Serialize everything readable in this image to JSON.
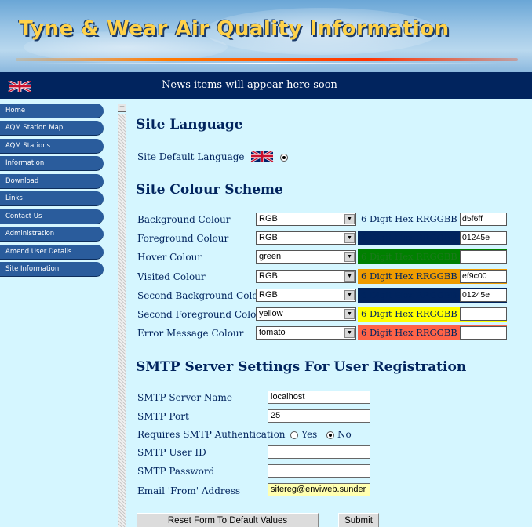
{
  "header": {
    "title": "Tyne & Wear Air Quality Information"
  },
  "newsbar": {
    "text": "News items will appear here soon",
    "flag_icon": "uk-flag-icon"
  },
  "sidebar": {
    "collapse_label": "−",
    "items": [
      {
        "label": "Home"
      },
      {
        "label": "AQM Station Map"
      },
      {
        "label": "AQM Stations"
      },
      {
        "label": "Information"
      },
      {
        "label": "Download"
      },
      {
        "label": "Links"
      },
      {
        "label": "Contact Us"
      },
      {
        "label": "Administration"
      },
      {
        "label": "Amend User Details"
      },
      {
        "label": "Site Information"
      }
    ]
  },
  "language": {
    "heading": "Site Language",
    "default_label": "Site Default Language"
  },
  "colours": {
    "heading": "Site Colour Scheme",
    "hex_label": "6 Digit Hex RRGGBB",
    "rows": [
      {
        "label": "Background Colour",
        "select": "RGB",
        "hex_value": "d5f6ff",
        "swatch": "#d5f6ff",
        "text_color": "#01245e"
      },
      {
        "label": "Foreground Colour",
        "select": "RGB",
        "hex_value": "01245e",
        "swatch": "#01245e",
        "text_color": "#01245e"
      },
      {
        "label": "Hover Colour",
        "select": "green",
        "hex_value": "",
        "swatch": "#008000",
        "text_color": "#1a7a1a"
      },
      {
        "label": "Visited Colour",
        "select": "RGB",
        "hex_value": "ef9c00",
        "swatch": "#ef9c00",
        "text_color": "#01245e"
      },
      {
        "label": "Second Background Colour",
        "select": "RGB",
        "hex_value": "01245e",
        "swatch": "#01245e",
        "text_color": "#01245e"
      },
      {
        "label": "Second Foreground Colour",
        "select": "yellow",
        "hex_value": "",
        "swatch": "#ffff00",
        "text_color": "#01245e"
      },
      {
        "label": "Error Message Colour",
        "select": "tomato",
        "hex_value": "",
        "swatch": "#ff6347",
        "text_color": "#01245e"
      }
    ]
  },
  "smtp": {
    "heading": "SMTP Server Settings For User Registration",
    "server_label": "SMTP Server Name",
    "server_value": "localhost",
    "port_label": "SMTP Port",
    "port_value": "25",
    "auth_label": "Requires SMTP Authentication",
    "auth_yes": "Yes",
    "auth_no": "No",
    "auth_selected": "No",
    "userid_label": "SMTP User ID",
    "userid_value": "",
    "password_label": "SMTP Password",
    "password_value": "",
    "from_label": "Email 'From' Address",
    "from_value": "sitereg@enviweb.sunder"
  },
  "buttons": {
    "reset": "Reset Form To Default Values",
    "submit": "Submit"
  },
  "colors": {
    "background": "#d5f6ff",
    "foreground": "#01245e",
    "nav": "#2a5c9c",
    "title": "#ffd24a"
  }
}
